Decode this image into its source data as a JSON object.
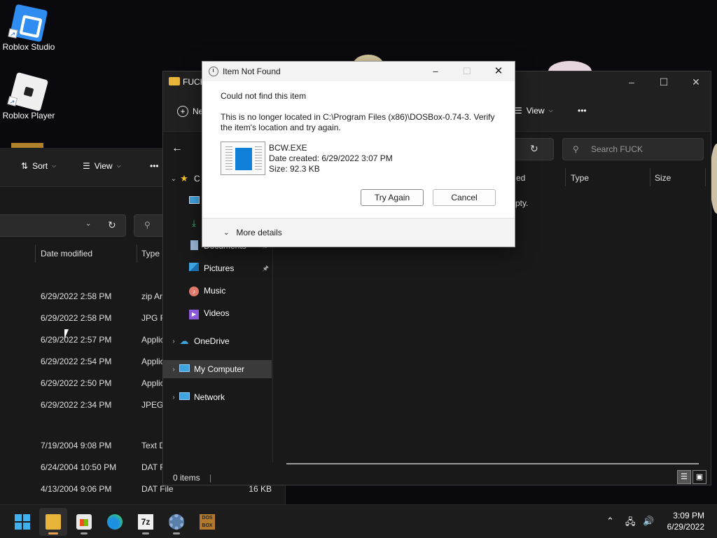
{
  "desktop": {
    "icons": [
      {
        "label": "Roblox Studio",
        "icon": "roblox-studio-icon"
      },
      {
        "label": "Roblox Player",
        "icon": "roblox-player-icon"
      }
    ]
  },
  "back_window": {
    "toolbar": {
      "sort_label": "Sort",
      "view_label": "View",
      "more_label": "•••"
    },
    "columns": {
      "date_modified": "Date modified",
      "type": "Type"
    },
    "rows": [
      {
        "date": "6/29/2022 2:58 PM",
        "type": "zip Ar"
      },
      {
        "date": "6/29/2022 2:58 PM",
        "type": "JPG Fi"
      },
      {
        "date": "6/29/2022 2:57 PM",
        "type": "Applic"
      },
      {
        "date": "6/29/2022 2:54 PM",
        "type": "Applic"
      },
      {
        "date": "6/29/2022 2:50 PM",
        "type": "Applic"
      },
      {
        "date": "6/29/2022 2:34 PM",
        "type": "JPEG I"
      },
      {
        "date": "7/19/2004 9:08 PM",
        "type": "Text D"
      },
      {
        "date": "6/24/2004 10:50 PM",
        "type": "DAT Fi"
      },
      {
        "date": "4/13/2004 9:06 PM",
        "type": "DAT File",
        "size": "16 KB"
      }
    ]
  },
  "front_window": {
    "title": "FUCK",
    "new_label": "Ne",
    "view_label": "View",
    "more_label": "•••",
    "search_placeholder": "Search FUCK",
    "columns": {
      "date_partial": "ed",
      "type": "Type",
      "size": "Size"
    },
    "empty_partial": "pty.",
    "nav_items": [
      {
        "label": "C",
        "icon": "star-icon",
        "expand": "⌄"
      },
      {
        "label": "",
        "icon": "desktop-icon"
      },
      {
        "label": "",
        "icon": "downloads-icon"
      },
      {
        "label": "Documents",
        "icon": "documents-icon",
        "pinned": true
      },
      {
        "label": "Pictures",
        "icon": "pictures-icon",
        "pinned": true
      },
      {
        "label": "Music",
        "icon": "music-icon"
      },
      {
        "label": "Videos",
        "icon": "videos-icon"
      },
      {
        "label": "OneDrive",
        "icon": "cloud-icon",
        "expand": "›"
      },
      {
        "label": "My Computer",
        "icon": "computer-icon",
        "expand": "›",
        "selected": true
      },
      {
        "label": "Network",
        "icon": "network-icon",
        "expand": "›"
      }
    ],
    "status_items": "0 items"
  },
  "dialog": {
    "title": "Item Not Found",
    "heading": "Could not find this item",
    "message": "This is no longer located in C:\\Program Files (x86)\\DOSBox-0.74-3. Verify the item's location and try again.",
    "file_name": "BCW.EXE",
    "date_created": "Date created: 6/29/2022 3:07 PM",
    "size": "Size: 92.3 KB",
    "try_again": "Try Again",
    "cancel": "Cancel",
    "more_details": "More details"
  },
  "taskbar": {
    "apps": [
      "start-icon",
      "file-explorer-icon",
      "store-icon",
      "edge-icon",
      "7zip-icon",
      "settings-icon",
      "dosbox-icon"
    ],
    "zip_label": "7z",
    "dos_label": "DOS BOX",
    "time": "3:09 PM",
    "date": "6/29/2022"
  },
  "colors": {
    "accent": "#0f7fd8",
    "folder": "#e8b43a",
    "taskbar": "#1c1c1c"
  }
}
